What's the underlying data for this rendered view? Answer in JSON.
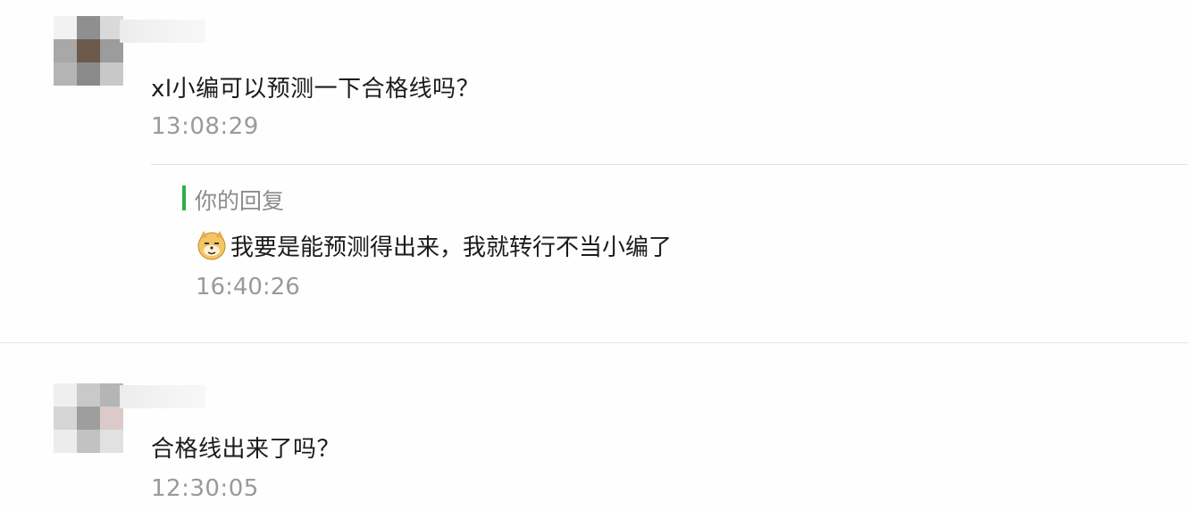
{
  "comments": [
    {
      "text": "xl小编可以预测一下合格线吗？",
      "time": "13:08:29",
      "reply": {
        "label": "你的回复",
        "emoji": "doge-emoji",
        "text": "我要是能预测得出来，我就转行不当小编了",
        "time": "16:40:26"
      }
    },
    {
      "text": "合格线出来了吗？",
      "time": "12:30:05"
    }
  ],
  "colors": {
    "reply_bar": "#2fae4b",
    "timestamp": "#9a9a9a",
    "text": "#1b1b1b"
  }
}
